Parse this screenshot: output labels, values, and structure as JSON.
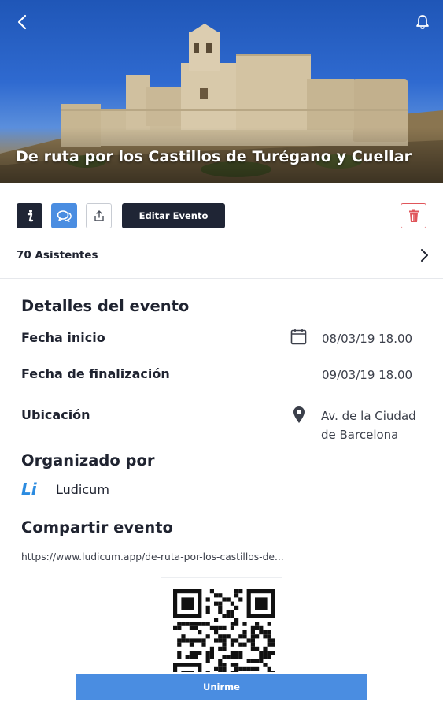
{
  "event": {
    "title": "De ruta por los Castillos de Turégano y Cuellar"
  },
  "header": {
    "back_icon": "chevron-left-icon",
    "bell_icon": "bell-icon"
  },
  "actions": {
    "info_icon": "info-icon",
    "chat_icon": "chat-bubbles-icon",
    "share_icon": "share-upload-icon",
    "edit_label": "Editar Evento",
    "delete_icon": "trash-icon",
    "attendees_label": "70 Asistentes"
  },
  "details": {
    "section_title": "Detalles del evento",
    "start_label": "Fecha inicio",
    "start_value": "08/03/19 18.00",
    "end_label": "Fecha de finalización",
    "end_value": "09/03/19 18.00",
    "location_label": "Ubicación",
    "location_line1": "Av. de la Ciudad",
    "location_line2": "de Barcelona"
  },
  "organizer": {
    "section_title": "Organizado por",
    "logo_text": "Li",
    "name": "Ludicum"
  },
  "share": {
    "section_title": "Compartir evento",
    "url": "https://www.ludicum.app/de-ruta-por-los-castillos-de..."
  },
  "footer": {
    "join_label": "Unirme"
  },
  "colors": {
    "primary_dark": "#1f2535",
    "accent_blue": "#4a8de1",
    "danger_red": "#e0555a",
    "logo_blue": "#2b8be0"
  }
}
